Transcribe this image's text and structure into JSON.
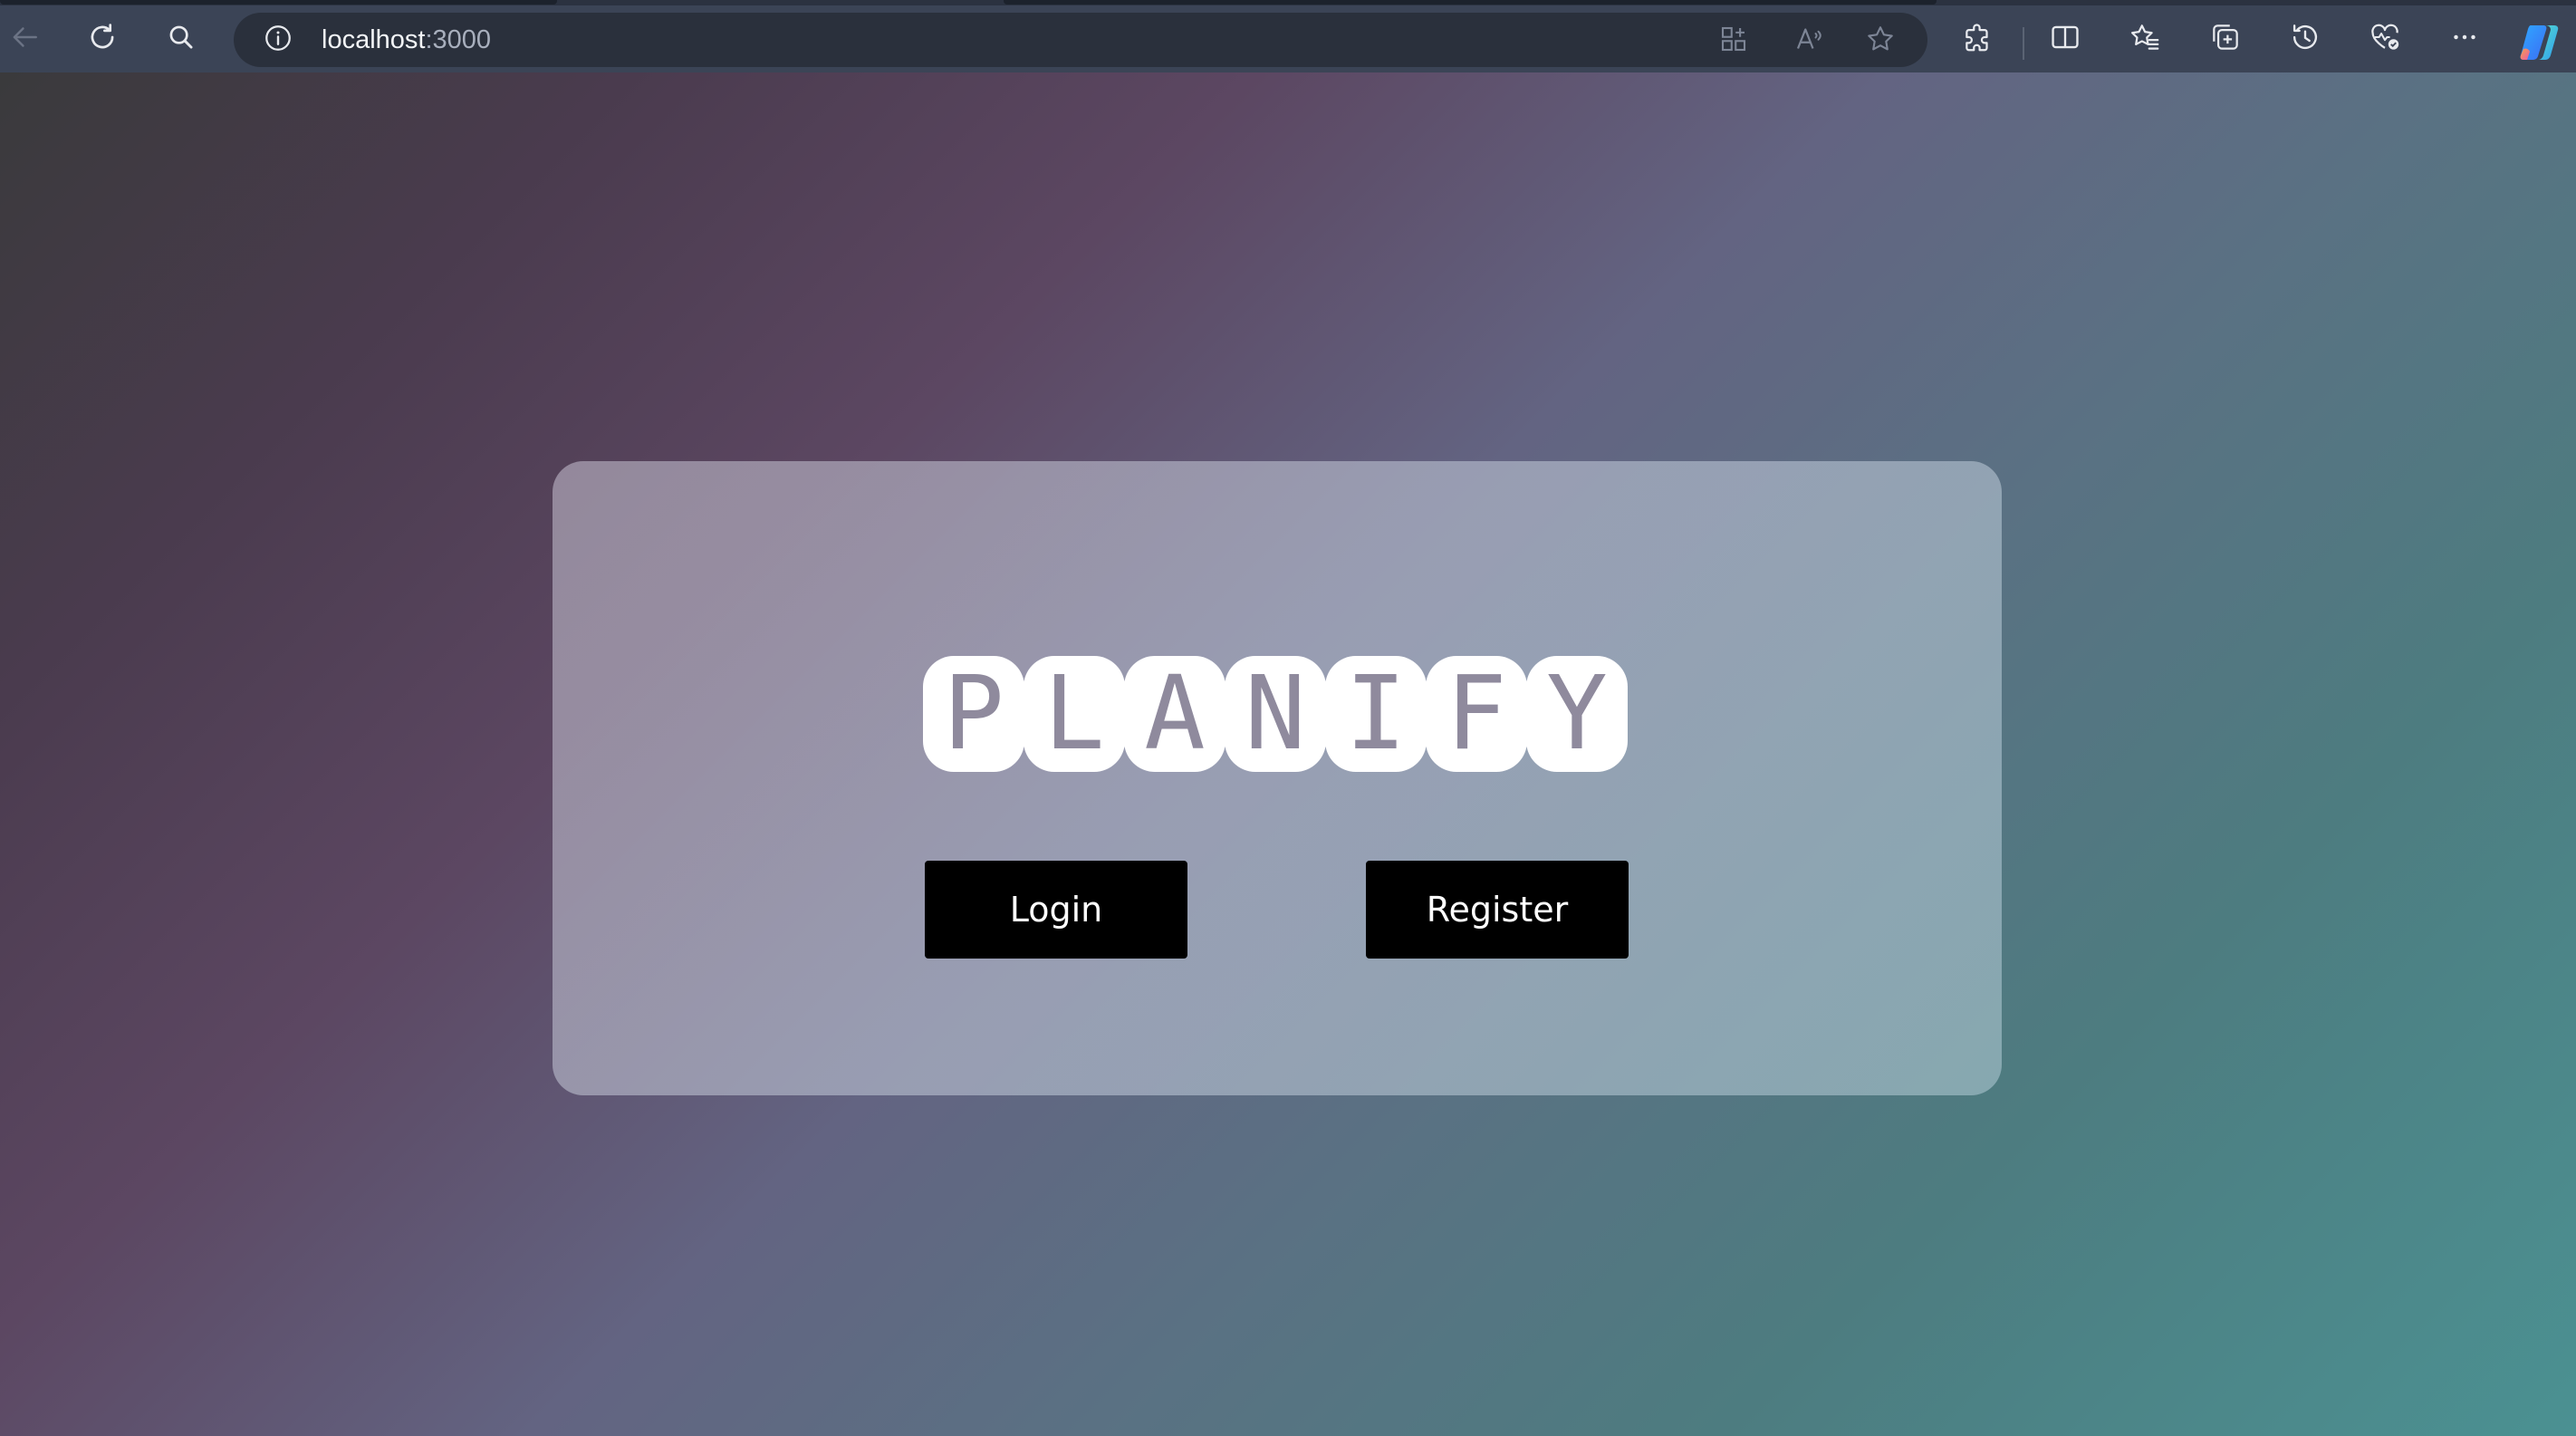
{
  "browser": {
    "address": {
      "host": "localhost",
      "port": ":3000"
    },
    "toolbar_icons": [
      "back-icon",
      "refresh-icon",
      "search-icon",
      "site-info-icon",
      "app-available-icon",
      "read-aloud-icon",
      "favorite-star-icon",
      "extensions-icon",
      "split-screen-icon",
      "favorites-icon",
      "collections-icon",
      "history-icon",
      "browser-essentials-icon",
      "more-options-icon",
      "copilot-icon"
    ]
  },
  "page": {
    "logo_letters": [
      "P",
      "L",
      "A",
      "N",
      "I",
      "F",
      "Y"
    ],
    "login_label": "Login",
    "register_label": "Register"
  },
  "colors": {
    "button_bg": "#000000",
    "button_text": "#ffffff",
    "logo_tile": "#ffffff",
    "logo_letter": "#8f8a9d"
  }
}
